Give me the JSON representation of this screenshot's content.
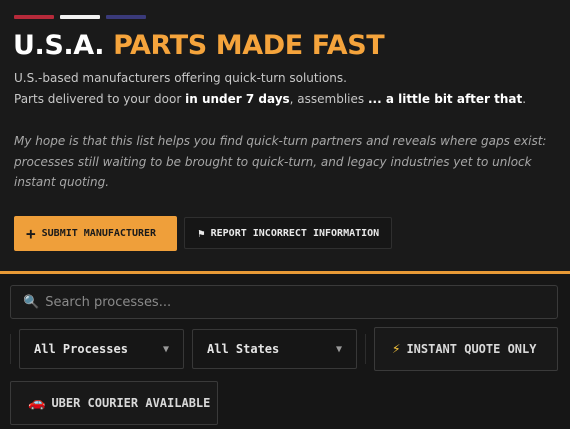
{
  "header": {
    "stripe_colors": [
      "#b62a3a",
      "#f2f2f2",
      "#3a3a7a"
    ],
    "title_white": "U.S.A.",
    "title_orange": "PARTS MADE FAST",
    "line1": "U.S.-based manufacturers offering quick-turn solutions.",
    "line2_prefix": "Parts delivered to your door ",
    "line2_bold1": "in under 7 days",
    "line2_mid": ", assemblies ",
    "line2_bold2": "... a little bit after that",
    "line2_suffix": ".",
    "quote": "My hope is that this list helps you find quick-turn partners and reveals where gaps exist: processes still waiting to be brought to quick-turn, and legacy industries yet to unlock instant quoting."
  },
  "actions": {
    "submit_icon": "+",
    "submit_label": "Submit Manufacturer",
    "report_icon": "⚑",
    "report_label": "Report Incorrect Information"
  },
  "filters": {
    "search_icon": "🔍",
    "search_placeholder": "Search processes...",
    "process_select": "All Processes",
    "state_select": "All States",
    "instant_icon": "⚡",
    "instant_label": "Instant Quote Only",
    "courier_icon": "🚗",
    "courier_label": "Uber Courier Available"
  },
  "colors": {
    "accent": "#ef9f3a",
    "background": "#161616"
  }
}
